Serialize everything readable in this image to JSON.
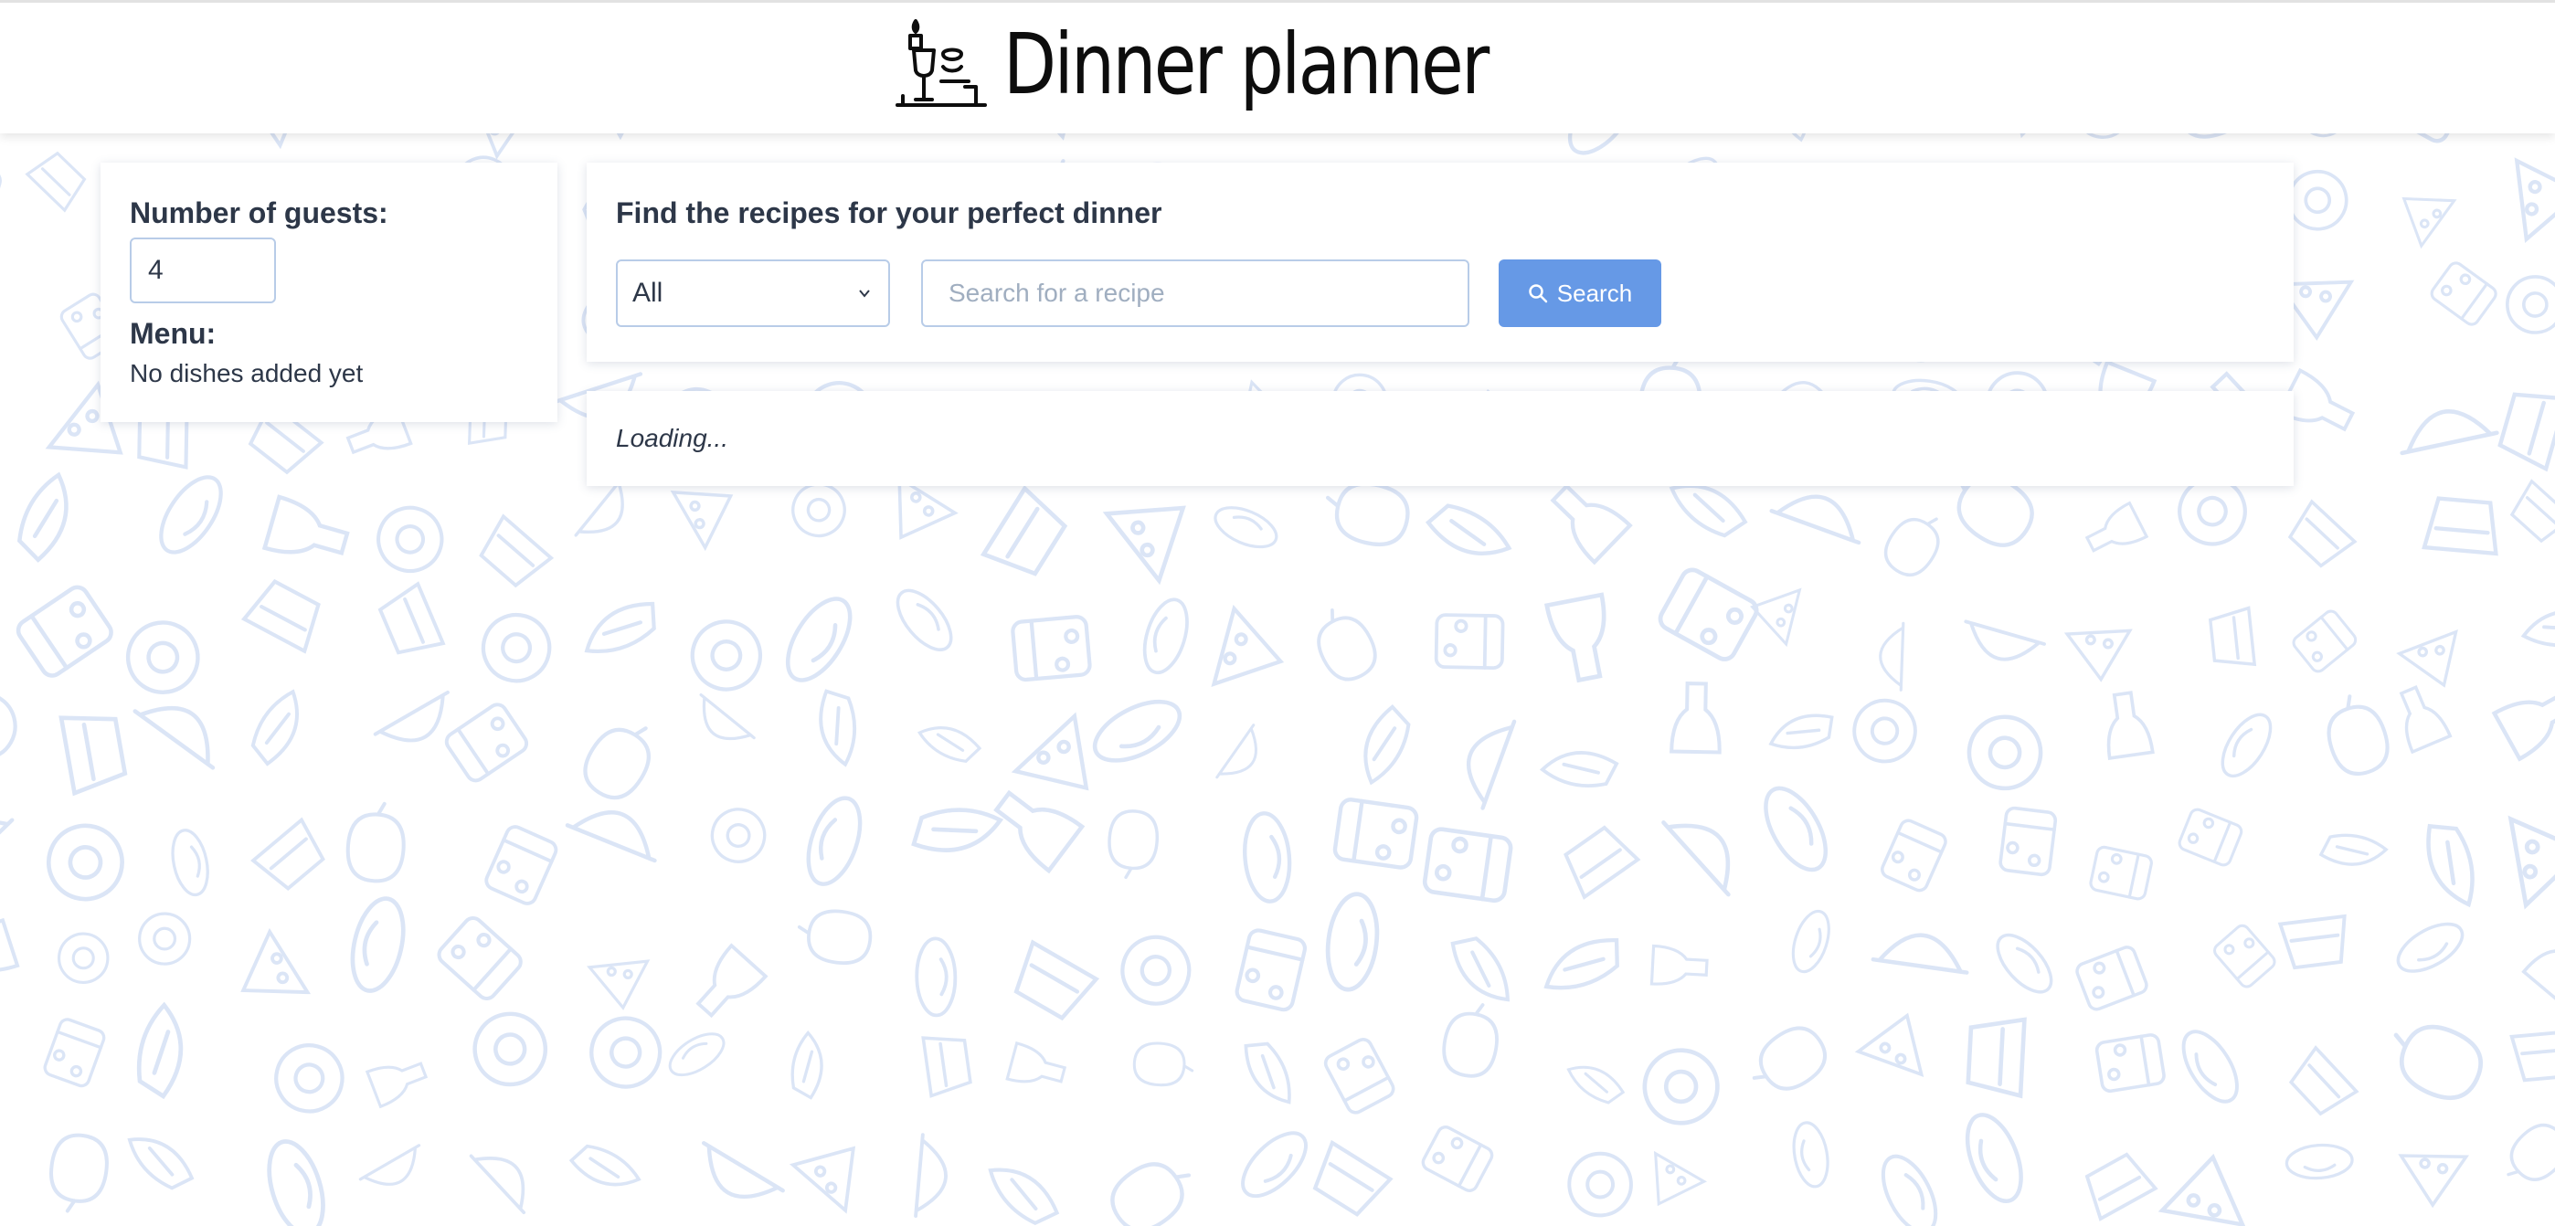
{
  "header": {
    "title": "Dinner planner",
    "logo_icon": "dinner-candle-wine-icon"
  },
  "theme": {
    "accent": "#6699e6",
    "doodle_color": "#dbe5f6",
    "text": "#2d3748",
    "input_border": "#b8cce8"
  },
  "sidebar": {
    "guests_label": "Number of guests:",
    "guests_value": "4",
    "menu_label": "Menu:",
    "menu_empty": "No dishes added yet"
  },
  "search": {
    "heading": "Find the recipes for your perfect dinner",
    "type_selected": "All",
    "placeholder": "Search for a recipe",
    "button_label": "Search",
    "button_icon": "search-icon"
  },
  "results": {
    "status": "Loading..."
  }
}
